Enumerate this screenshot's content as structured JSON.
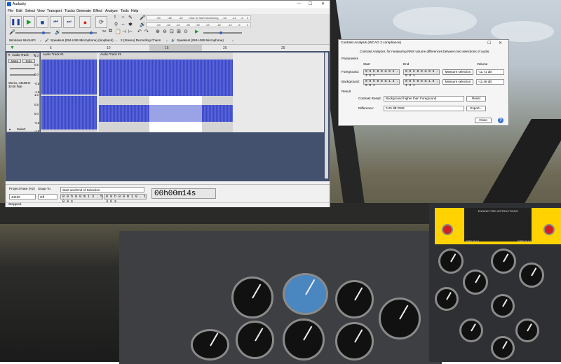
{
  "window": {
    "title": "Audacity",
    "controls": [
      "—",
      "☐",
      "✕"
    ]
  },
  "menu": [
    "File",
    "Edit",
    "Select",
    "View",
    "Transport",
    "Tracks",
    "Generate",
    "Effect",
    "Analyze",
    "Tools",
    "Help"
  ],
  "toolbar": {
    "monitor_label": "Click to Start Monitoring",
    "meter_ticks_top": [
      "-54",
      "-48",
      "-42",
      "-18",
      "-12",
      "-6",
      "0"
    ],
    "meter_ticks_bottom": [
      "-54",
      "-48",
      "-42",
      "-36",
      "-30",
      "-24",
      "-18",
      "-12",
      "-6",
      "0"
    ]
  },
  "devices": {
    "host": "Windows WASAPI",
    "recording_device": "Speakers (EM-USB Microphone) (loopback)",
    "channels": "2 (Stereo) Recording Chann",
    "playback_device": "Speakers (EM-USB Microphone)"
  },
  "ruler": {
    "ticks": [
      "5",
      "10",
      "15",
      "20",
      "25"
    ]
  },
  "track": {
    "name": "Audio Track",
    "clip1": "Audio Track #1",
    "clip2": "Audio Track #2",
    "mute": "Mute",
    "solo": "Solo",
    "info": "Stereo, 44100Hz\n32-bit float",
    "select": "Select",
    "scale": [
      "1.0",
      "0.5",
      "0.0",
      "-0.5",
      "-1.0",
      "1.0",
      "0.5",
      "0.0",
      "-0.5",
      "-1.0"
    ]
  },
  "selection_bar": {
    "project_rate_label": "Project Rate (Hz)",
    "project_rate": "44100",
    "snap_label": "Snap-To",
    "snap_value": "Off",
    "selection_mode": "Start and End of Selection",
    "start": "0 0 h 0 0 m 1 3 . 5 8 4 s",
    "end": "0 0 h 0 0 m 1 0 . 1 3 6 s",
    "big_time": "00h00m14s"
  },
  "status": "Stopped.",
  "dialog": {
    "title": "Contrast Analysis (WCAG 2 compliance)",
    "description": "Contrast Analyzer, for measuring RMS volume differences between two selections of audio.",
    "parameters_label": "Parameters",
    "start_label": "Start",
    "end_label": "End",
    "volume_label": "Volume",
    "foreground_label": "Foreground:",
    "background_label": "Background:",
    "fg_start": "0 0 h 0 0 m 0 2 . 4 5 s",
    "fg_end": "0 0 h 0 0 m 0 6 . 8 6 s",
    "bg_start": "0 0 h 0 0 m 1 3 . 5 8 s",
    "bg_end": "0 0 h 0 0 m 1 8 . 1 3 s",
    "measure_label": "Measure selection",
    "fg_volume": "-11.71 dB",
    "bg_volume": "-11.46 dB",
    "result_label": "Result",
    "contrast_result_label": "Contrast Result:",
    "contrast_result": "Background higher than Foreground",
    "difference_label": "Difference:",
    "difference": "0.25 dB RMS",
    "reset_label": "Reset",
    "export_label": "Export...",
    "close_label": "Close",
    "help_label": "?"
  },
  "cockpit": {
    "fire_header": "ENGINE FIRE INSTRUCTIONS",
    "fire_pull": "FIRE PULL"
  },
  "colors": {
    "waveform": "#3b48c8",
    "track_bg": "#44516e",
    "selection": "#ffffff",
    "fire_panel": "#ffd200"
  }
}
